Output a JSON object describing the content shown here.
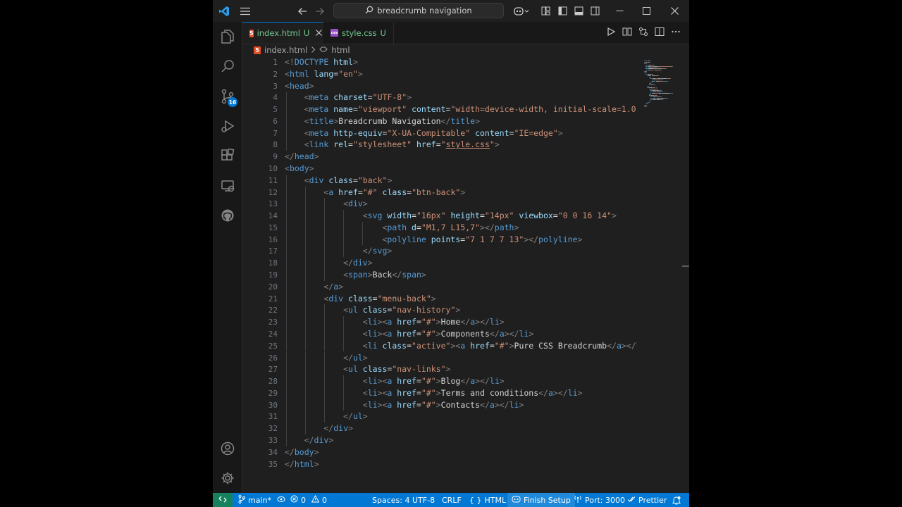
{
  "titlebar": {
    "search_text": "breadcrumb navigation"
  },
  "activity": {
    "scm_badge": "16"
  },
  "tabs": [
    {
      "label": "index.html",
      "status": "U"
    },
    {
      "label": "style.css",
      "status": "U"
    }
  ],
  "breadcrumb": {
    "file": "index.html",
    "symbol": "html"
  },
  "editor": {
    "line_numbers": [
      "1",
      "2",
      "3",
      "4",
      "5",
      "6",
      "7",
      "8",
      "9",
      "10",
      "11",
      "12",
      "13",
      "14",
      "15",
      "16",
      "17",
      "18",
      "19",
      "20",
      "21",
      "22",
      "23",
      "24",
      "25",
      "26",
      "27",
      "28",
      "29",
      "30",
      "31",
      "32",
      "33",
      "34",
      "35"
    ],
    "lines": [
      [
        {
          "t": "<!",
          "c": "br"
        },
        {
          "t": "DOCTYPE",
          "c": "doc"
        },
        {
          "t": " html",
          "c": "attr"
        },
        {
          "t": ">",
          "c": "br"
        }
      ],
      [
        {
          "t": "<",
          "c": "br"
        },
        {
          "t": "html",
          "c": "tag"
        },
        {
          "t": " lang",
          "c": "attr"
        },
        {
          "t": "=",
          "c": "txt"
        },
        {
          "t": "\"en\"",
          "c": "val"
        },
        {
          "t": ">",
          "c": "br"
        }
      ],
      [
        {
          "t": "<",
          "c": "br"
        },
        {
          "t": "head",
          "c": "tag"
        },
        {
          "t": ">",
          "c": "br"
        }
      ],
      [
        {
          "t": "    <",
          "c": "br"
        },
        {
          "t": "meta",
          "c": "tag"
        },
        {
          "t": " charset",
          "c": "attr"
        },
        {
          "t": "=",
          "c": "txt"
        },
        {
          "t": "\"UTF-8\"",
          "c": "val"
        },
        {
          "t": ">",
          "c": "br"
        }
      ],
      [
        {
          "t": "    <",
          "c": "br"
        },
        {
          "t": "meta",
          "c": "tag"
        },
        {
          "t": " name",
          "c": "attr"
        },
        {
          "t": "=",
          "c": "txt"
        },
        {
          "t": "\"viewport\"",
          "c": "val"
        },
        {
          "t": " content",
          "c": "attr"
        },
        {
          "t": "=",
          "c": "txt"
        },
        {
          "t": "\"width=device-width, initial-scale=1.0\"",
          "c": "val"
        },
        {
          "t": ">",
          "c": "br"
        }
      ],
      [
        {
          "t": "    <",
          "c": "br"
        },
        {
          "t": "title",
          "c": "tag"
        },
        {
          "t": ">",
          "c": "br"
        },
        {
          "t": "Breadcrumb Navigation",
          "c": "txt"
        },
        {
          "t": "</",
          "c": "br"
        },
        {
          "t": "title",
          "c": "tag"
        },
        {
          "t": ">",
          "c": "br"
        }
      ],
      [
        {
          "t": "    <",
          "c": "br"
        },
        {
          "t": "meta",
          "c": "tag"
        },
        {
          "t": " http-equiv",
          "c": "attr"
        },
        {
          "t": "=",
          "c": "txt"
        },
        {
          "t": "\"X-UA-Compitable\"",
          "c": "val"
        },
        {
          "t": " content",
          "c": "attr"
        },
        {
          "t": "=",
          "c": "txt"
        },
        {
          "t": "\"IE=edge\"",
          "c": "val"
        },
        {
          "t": ">",
          "c": "br"
        }
      ],
      [
        {
          "t": "    <",
          "c": "br"
        },
        {
          "t": "link",
          "c": "tag"
        },
        {
          "t": " rel",
          "c": "attr"
        },
        {
          "t": "=",
          "c": "txt"
        },
        {
          "t": "\"stylesheet\"",
          "c": "val"
        },
        {
          "t": " href",
          "c": "attr"
        },
        {
          "t": "=",
          "c": "txt"
        },
        {
          "t": "\"",
          "c": "val"
        },
        {
          "t": "style.css",
          "c": "link"
        },
        {
          "t": "\"",
          "c": "val"
        },
        {
          "t": ">",
          "c": "br"
        }
      ],
      [
        {
          "t": "</",
          "c": "br"
        },
        {
          "t": "head",
          "c": "tag"
        },
        {
          "t": ">",
          "c": "br"
        }
      ],
      [
        {
          "t": "<",
          "c": "br"
        },
        {
          "t": "body",
          "c": "tag"
        },
        {
          "t": ">",
          "c": "br"
        }
      ],
      [
        {
          "t": "    <",
          "c": "br"
        },
        {
          "t": "div",
          "c": "tag"
        },
        {
          "t": " class",
          "c": "attr"
        },
        {
          "t": "=",
          "c": "txt"
        },
        {
          "t": "\"back\"",
          "c": "val"
        },
        {
          "t": ">",
          "c": "br"
        }
      ],
      [
        {
          "t": "        <",
          "c": "br"
        },
        {
          "t": "a",
          "c": "tag"
        },
        {
          "t": " href",
          "c": "attr"
        },
        {
          "t": "=",
          "c": "txt"
        },
        {
          "t": "\"#\"",
          "c": "val"
        },
        {
          "t": " class",
          "c": "attr"
        },
        {
          "t": "=",
          "c": "txt"
        },
        {
          "t": "\"btn-back\"",
          "c": "val"
        },
        {
          "t": ">",
          "c": "br"
        }
      ],
      [
        {
          "t": "            <",
          "c": "br"
        },
        {
          "t": "div",
          "c": "tag"
        },
        {
          "t": ">",
          "c": "br"
        }
      ],
      [
        {
          "t": "                <",
          "c": "br"
        },
        {
          "t": "svg",
          "c": "tag"
        },
        {
          "t": " width",
          "c": "attr"
        },
        {
          "t": "=",
          "c": "txt"
        },
        {
          "t": "\"16px\"",
          "c": "val"
        },
        {
          "t": " height",
          "c": "attr"
        },
        {
          "t": "=",
          "c": "txt"
        },
        {
          "t": "\"14px\"",
          "c": "val"
        },
        {
          "t": " viewbox",
          "c": "attr"
        },
        {
          "t": "=",
          "c": "txt"
        },
        {
          "t": "\"0 0 16 14\"",
          "c": "val"
        },
        {
          "t": ">",
          "c": "br"
        }
      ],
      [
        {
          "t": "                    <",
          "c": "br"
        },
        {
          "t": "path",
          "c": "tag"
        },
        {
          "t": " d",
          "c": "attr"
        },
        {
          "t": "=",
          "c": "txt"
        },
        {
          "t": "\"M1,7 L15,7\"",
          "c": "val"
        },
        {
          "t": "></",
          "c": "br"
        },
        {
          "t": "path",
          "c": "tag"
        },
        {
          "t": ">",
          "c": "br"
        }
      ],
      [
        {
          "t": "                    <",
          "c": "br"
        },
        {
          "t": "polyline",
          "c": "tag"
        },
        {
          "t": " points",
          "c": "attr"
        },
        {
          "t": "=",
          "c": "txt"
        },
        {
          "t": "\"7 1 7 7 13\"",
          "c": "val"
        },
        {
          "t": "></",
          "c": "br"
        },
        {
          "t": "polyline",
          "c": "tag"
        },
        {
          "t": ">",
          "c": "br"
        }
      ],
      [
        {
          "t": "                </",
          "c": "br"
        },
        {
          "t": "svg",
          "c": "tag"
        },
        {
          "t": ">",
          "c": "br"
        }
      ],
      [
        {
          "t": "            </",
          "c": "br"
        },
        {
          "t": "div",
          "c": "tag"
        },
        {
          "t": ">",
          "c": "br"
        }
      ],
      [
        {
          "t": "            <",
          "c": "br"
        },
        {
          "t": "span",
          "c": "tag"
        },
        {
          "t": ">",
          "c": "br"
        },
        {
          "t": "Back",
          "c": "txt"
        },
        {
          "t": "</",
          "c": "br"
        },
        {
          "t": "span",
          "c": "tag"
        },
        {
          "t": ">",
          "c": "br"
        }
      ],
      [
        {
          "t": "        </",
          "c": "br"
        },
        {
          "t": "a",
          "c": "tag"
        },
        {
          "t": ">",
          "c": "br"
        }
      ],
      [
        {
          "t": "        <",
          "c": "br"
        },
        {
          "t": "div",
          "c": "tag"
        },
        {
          "t": " class",
          "c": "attr"
        },
        {
          "t": "=",
          "c": "txt"
        },
        {
          "t": "\"menu-back\"",
          "c": "val"
        },
        {
          "t": ">",
          "c": "br"
        }
      ],
      [
        {
          "t": "            <",
          "c": "br"
        },
        {
          "t": "ul",
          "c": "tag"
        },
        {
          "t": " class",
          "c": "attr"
        },
        {
          "t": "=",
          "c": "txt"
        },
        {
          "t": "\"nav-history\"",
          "c": "val"
        },
        {
          "t": ">",
          "c": "br"
        }
      ],
      [
        {
          "t": "                <",
          "c": "br"
        },
        {
          "t": "li",
          "c": "tag"
        },
        {
          "t": "><",
          "c": "br"
        },
        {
          "t": "a",
          "c": "tag"
        },
        {
          "t": " href",
          "c": "attr"
        },
        {
          "t": "=",
          "c": "txt"
        },
        {
          "t": "\"#\"",
          "c": "val"
        },
        {
          "t": ">",
          "c": "br"
        },
        {
          "t": "Home",
          "c": "txt"
        },
        {
          "t": "</",
          "c": "br"
        },
        {
          "t": "a",
          "c": "tag"
        },
        {
          "t": "></",
          "c": "br"
        },
        {
          "t": "li",
          "c": "tag"
        },
        {
          "t": ">",
          "c": "br"
        }
      ],
      [
        {
          "t": "                <",
          "c": "br"
        },
        {
          "t": "li",
          "c": "tag"
        },
        {
          "t": "><",
          "c": "br"
        },
        {
          "t": "a",
          "c": "tag"
        },
        {
          "t": " href",
          "c": "attr"
        },
        {
          "t": "=",
          "c": "txt"
        },
        {
          "t": "\"#\"",
          "c": "val"
        },
        {
          "t": ">",
          "c": "br"
        },
        {
          "t": "Components",
          "c": "txt"
        },
        {
          "t": "</",
          "c": "br"
        },
        {
          "t": "a",
          "c": "tag"
        },
        {
          "t": "></",
          "c": "br"
        },
        {
          "t": "li",
          "c": "tag"
        },
        {
          "t": ">",
          "c": "br"
        }
      ],
      [
        {
          "t": "                <",
          "c": "br"
        },
        {
          "t": "li",
          "c": "tag"
        },
        {
          "t": " class",
          "c": "attr"
        },
        {
          "t": "=",
          "c": "txt"
        },
        {
          "t": "\"active\"",
          "c": "val"
        },
        {
          "t": "><",
          "c": "br"
        },
        {
          "t": "a",
          "c": "tag"
        },
        {
          "t": " href",
          "c": "attr"
        },
        {
          "t": "=",
          "c": "txt"
        },
        {
          "t": "\"#\"",
          "c": "val"
        },
        {
          "t": ">",
          "c": "br"
        },
        {
          "t": "Pure CSS Breadcrumb",
          "c": "txt"
        },
        {
          "t": "</",
          "c": "br"
        },
        {
          "t": "a",
          "c": "tag"
        },
        {
          "t": "></",
          "c": "br"
        },
        {
          "t": "li",
          "c": "tag"
        }
      ],
      [
        {
          "t": "            </",
          "c": "br"
        },
        {
          "t": "ul",
          "c": "tag"
        },
        {
          "t": ">",
          "c": "br"
        }
      ],
      [
        {
          "t": "            <",
          "c": "br"
        },
        {
          "t": "ul",
          "c": "tag"
        },
        {
          "t": " class",
          "c": "attr"
        },
        {
          "t": "=",
          "c": "txt"
        },
        {
          "t": "\"nav-links\"",
          "c": "val"
        },
        {
          "t": ">",
          "c": "br"
        }
      ],
      [
        {
          "t": "                <",
          "c": "br"
        },
        {
          "t": "li",
          "c": "tag"
        },
        {
          "t": "><",
          "c": "br"
        },
        {
          "t": "a",
          "c": "tag"
        },
        {
          "t": " href",
          "c": "attr"
        },
        {
          "t": "=",
          "c": "txt"
        },
        {
          "t": "\"#\"",
          "c": "val"
        },
        {
          "t": ">",
          "c": "br"
        },
        {
          "t": "Blog",
          "c": "txt"
        },
        {
          "t": "</",
          "c": "br"
        },
        {
          "t": "a",
          "c": "tag"
        },
        {
          "t": "></",
          "c": "br"
        },
        {
          "t": "li",
          "c": "tag"
        },
        {
          "t": ">",
          "c": "br"
        }
      ],
      [
        {
          "t": "                <",
          "c": "br"
        },
        {
          "t": "li",
          "c": "tag"
        },
        {
          "t": "><",
          "c": "br"
        },
        {
          "t": "a",
          "c": "tag"
        },
        {
          "t": " href",
          "c": "attr"
        },
        {
          "t": "=",
          "c": "txt"
        },
        {
          "t": "\"#\"",
          "c": "val"
        },
        {
          "t": ">",
          "c": "br"
        },
        {
          "t": "Terms and conditions",
          "c": "txt"
        },
        {
          "t": "</",
          "c": "br"
        },
        {
          "t": "a",
          "c": "tag"
        },
        {
          "t": "></",
          "c": "br"
        },
        {
          "t": "li",
          "c": "tag"
        },
        {
          "t": ">",
          "c": "br"
        }
      ],
      [
        {
          "t": "                <",
          "c": "br"
        },
        {
          "t": "li",
          "c": "tag"
        },
        {
          "t": "><",
          "c": "br"
        },
        {
          "t": "a",
          "c": "tag"
        },
        {
          "t": " href",
          "c": "attr"
        },
        {
          "t": "=",
          "c": "txt"
        },
        {
          "t": "\"#\"",
          "c": "val"
        },
        {
          "t": ">",
          "c": "br"
        },
        {
          "t": "Contacts",
          "c": "txt"
        },
        {
          "t": "</",
          "c": "br"
        },
        {
          "t": "a",
          "c": "tag"
        },
        {
          "t": "></",
          "c": "br"
        },
        {
          "t": "li",
          "c": "tag"
        },
        {
          "t": ">",
          "c": "br"
        }
      ],
      [
        {
          "t": "            </",
          "c": "br"
        },
        {
          "t": "ul",
          "c": "tag"
        },
        {
          "t": ">",
          "c": "br"
        }
      ],
      [
        {
          "t": "        </",
          "c": "br"
        },
        {
          "t": "div",
          "c": "tag"
        },
        {
          "t": ">",
          "c": "br"
        }
      ],
      [
        {
          "t": "    </",
          "c": "br"
        },
        {
          "t": "div",
          "c": "tag"
        },
        {
          "t": ">",
          "c": "br"
        }
      ],
      [
        {
          "t": "</",
          "c": "br"
        },
        {
          "t": "body",
          "c": "tag"
        },
        {
          "t": ">",
          "c": "br"
        }
      ],
      [
        {
          "t": "</",
          "c": "br"
        },
        {
          "t": "html",
          "c": "tag"
        },
        {
          "t": ">",
          "c": "br"
        }
      ]
    ]
  },
  "statusbar": {
    "branch": "main*",
    "errors": "0",
    "warnings": "0",
    "spaces": "Spaces: 4",
    "encoding": "UTF-8",
    "eol": "CRLF",
    "language": "HTML",
    "finish_setup": "Finish Setup",
    "port": "Port: 3000",
    "prettier": "Prettier"
  },
  "colors": {
    "accent": "#0078d4",
    "remote": "#16825d",
    "untracked": "#73c991",
    "tag": "#569cd6",
    "attribute": "#9cdcfe",
    "string": "#ce9178"
  }
}
